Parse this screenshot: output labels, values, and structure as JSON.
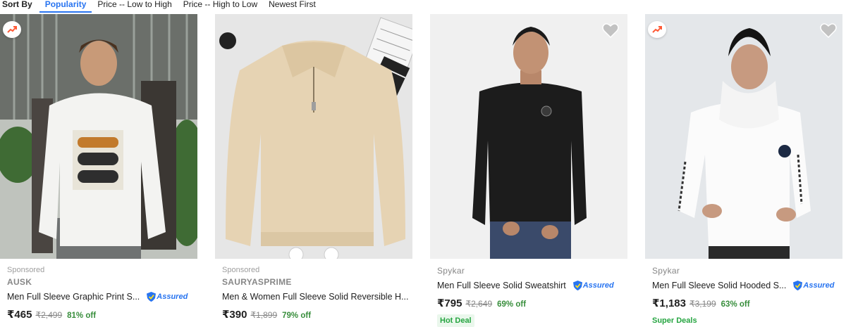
{
  "sort": {
    "label": "Sort By",
    "options": [
      "Popularity",
      "Price -- Low to High",
      "Price -- High to Low",
      "Newest First"
    ],
    "active": "Popularity"
  },
  "products": [
    {
      "sponsored": "Sponsored",
      "brand": "AUSK",
      "title": "Men Full Sleeve Graphic Print S...",
      "assured": "Assured",
      "price": "₹465",
      "mrp": "₹2,499",
      "discount": "81% off",
      "tag": "",
      "image_description": "white-graphic-sweatshirt-photo"
    },
    {
      "sponsored": "Sponsored",
      "brand": "SAURYASPRIME",
      "title": "Men & Women Full Sleeve Solid Reversible H...",
      "assured": "",
      "price": "₹390",
      "mrp": "₹1,899",
      "discount": "79% off",
      "tag": "",
      "image_description": "beige-half-zip-sweatshirt-photo"
    },
    {
      "sponsored": "",
      "brand": "Spykar",
      "title": "Men Full Sleeve Solid Sweatshirt",
      "assured": "Assured",
      "price": "₹795",
      "mrp": "₹2,649",
      "discount": "69% off",
      "tag": "Hot Deal",
      "image_description": "black-sweatshirt-model-photo"
    },
    {
      "sponsored": "",
      "brand": "Spykar",
      "title": "Men Full Sleeve Solid Hooded S...",
      "assured": "Assured",
      "price": "₹1,183",
      "mrp": "₹3,199",
      "discount": "63% off",
      "tag": "Super Deals",
      "image_description": "white-hoodie-model-photo"
    }
  ],
  "colors": {
    "accent": "#2874f0",
    "discount": "#388e3c",
    "deal": "#26a541",
    "trend": "#ff5a36"
  }
}
